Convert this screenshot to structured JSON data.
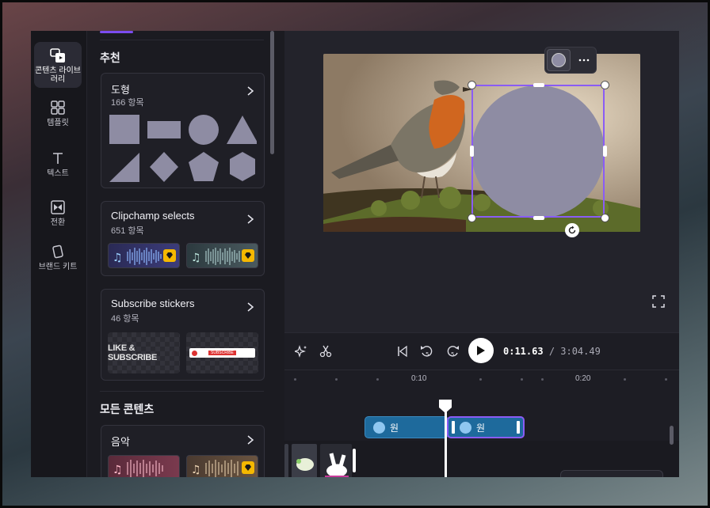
{
  "rail": {
    "peek_label": "🔆",
    "items": [
      {
        "label": "콘텐츠 라이브러리",
        "icon": "content-library-icon",
        "active": true
      },
      {
        "label": "템플릿",
        "icon": "templates-icon"
      },
      {
        "label": "텍스트",
        "icon": "text-icon"
      },
      {
        "label": "전환",
        "icon": "transitions-icon"
      },
      {
        "label": "브랜드 키트",
        "icon": "brand-kit-icon"
      }
    ]
  },
  "panel": {
    "recommended_title": "추천",
    "all_content_title": "모든 콘텐츠",
    "cards": {
      "shapes": {
        "title": "도형",
        "count": "166 항목"
      },
      "clipchamp": {
        "title": "Clipchamp selects",
        "count": "651 항목"
      },
      "stickers": {
        "title": "Subscribe stickers",
        "count": "46 항목",
        "sticker1": "LIKE & SUBSCRIBE",
        "sticker2": "SUBSCRIBE"
      },
      "music": {
        "title": "음악"
      }
    }
  },
  "timeline": {
    "timecode_current": "0:11.63",
    "timecode_total": "/ 3:04.49",
    "ruler_labels": [
      "0:10",
      "0:20"
    ],
    "clips": [
      {
        "label": "원",
        "color": "#1e6a9c"
      },
      {
        "label": "원",
        "color": "#1e6a9c"
      }
    ],
    "skip_back": "5",
    "skip_fwd": "5"
  },
  "colors": {
    "accent": "#7b4cf0",
    "shape_fill": "#8e8ca3",
    "clip_selected_border": "#8a5cf5"
  }
}
